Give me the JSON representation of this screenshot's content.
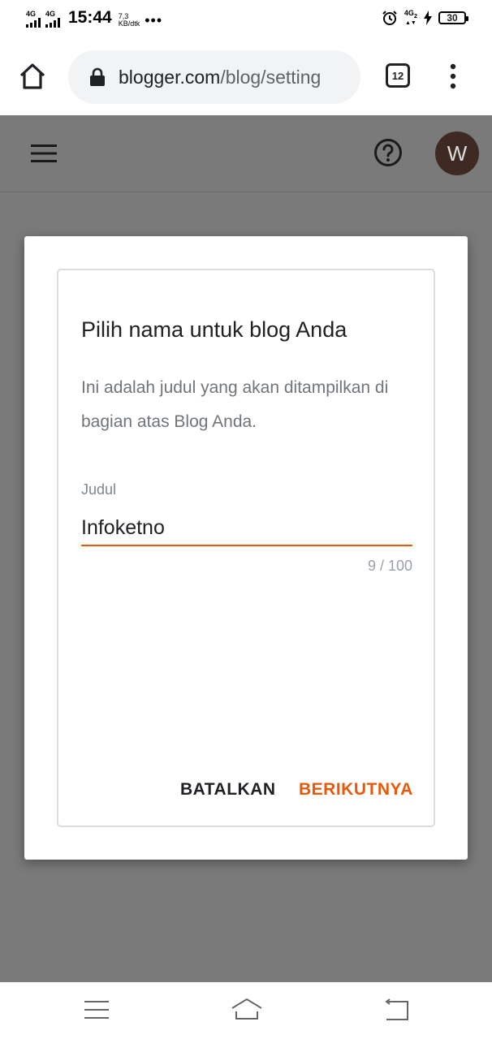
{
  "status_bar": {
    "signal1_label": "4G",
    "signal2_label": "4G",
    "time": "15:44",
    "speed_value": "7,3",
    "speed_unit": "KB/dtk",
    "more_dots": "•••",
    "lte_label": "4G",
    "lte_sub": "2",
    "battery_level": "30"
  },
  "browser": {
    "url_host": "blogger.com",
    "url_path": "/blog/setting",
    "tab_count": "12"
  },
  "app_header": {
    "avatar_initial": "W"
  },
  "dialog": {
    "title": "Pilih nama untuk blog Anda",
    "description": "Ini adalah judul yang akan ditampilkan di bagian atas Blog Anda.",
    "field_label": "Judul",
    "field_value": "Infoketno",
    "counter": "9 / 100",
    "cancel_label": "BATALKAN",
    "next_label": "BERIKUTNYA"
  },
  "colors": {
    "accent": "#e8590c",
    "overlay": "#7a7a7a",
    "avatar_bg": "#3e2a22"
  },
  "icons": [
    "home-icon",
    "lock-icon",
    "tabs-icon",
    "more-vert-icon",
    "menu-icon",
    "help-icon",
    "nav-menu-icon",
    "nav-home-icon",
    "nav-back-icon"
  ]
}
